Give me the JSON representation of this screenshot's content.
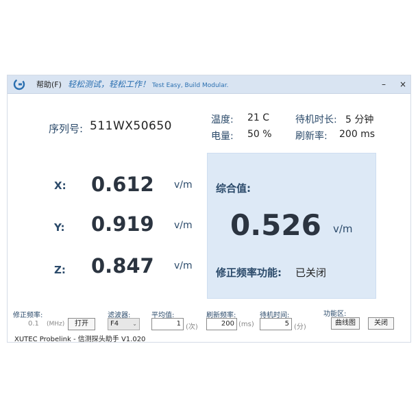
{
  "titlebar": {
    "menu_help": "帮助(F)",
    "slogan_cn": "轻松测试，轻松工作！",
    "slogan_en": "Test Easy, Build Modular.",
    "minimize": "–",
    "close": "×"
  },
  "info": {
    "serial_label": "序列号:",
    "serial_value": "511WX50650",
    "temp_label": "温度:",
    "temp_value": "21 C",
    "battery_label": "电量:",
    "battery_value": "50 %",
    "standby_label": "待机时长:",
    "standby_value": "5 分钟",
    "refresh_label": "刷新率:",
    "refresh_value": "200 ms"
  },
  "axes": [
    {
      "label": "X:",
      "value": "0.612",
      "unit": "v/m"
    },
    {
      "label": "Y:",
      "value": "0.919",
      "unit": "v/m"
    },
    {
      "label": "Z:",
      "value": "0.847",
      "unit": "v/m"
    }
  ],
  "composite": {
    "title": "综合值:",
    "value": "0.526",
    "unit": "v/m",
    "correction_label": "修正频率功能:",
    "correction_value": "已关闭"
  },
  "controls": {
    "corr_freq_label": "修正频率:",
    "corr_freq_value": "0.1",
    "corr_freq_unit": "(MHz)",
    "open_button": "打开",
    "filter_label": "滤波器:",
    "filter_value": "F4",
    "avg_label": "平均值:",
    "avg_value": "1",
    "avg_unit": "(次)",
    "refresh_label": "刷新频率:",
    "refresh_value": "200",
    "refresh_unit": "(ms)",
    "standby_label": "待机时间:",
    "standby_value": "5",
    "standby_unit": "(分)",
    "func_label": "功能区:",
    "curve_button": "曲线图",
    "close_button": "关闭"
  },
  "footer": "XUTEC Probelink - 信测探头助手 V1.020",
  "colors": {
    "titlebar_bg": "#d9e4f2",
    "panel_bg": "#dde9f6",
    "label_blue": "#2b4a6a",
    "slogan_blue": "#2a6fb0"
  }
}
